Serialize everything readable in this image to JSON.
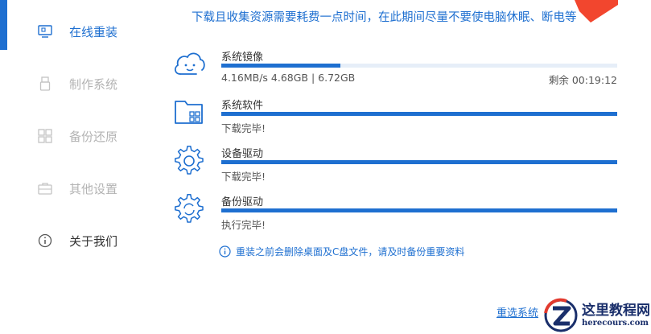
{
  "sidebar": {
    "items": [
      {
        "label": "在线重装",
        "icon": "monitor-icon",
        "state": "active"
      },
      {
        "label": "制作系统",
        "icon": "usb-icon",
        "state": "disabled"
      },
      {
        "label": "备份还原",
        "icon": "grid-icon",
        "state": "disabled"
      },
      {
        "label": "其他设置",
        "icon": "briefcase-icon",
        "state": "disabled"
      },
      {
        "label": "关于我们",
        "icon": "info-icon",
        "state": "normal"
      }
    ]
  },
  "header": {
    "message": "下载且收集资源需要耗费一点时间，在此期间尽量不要使电脑休眠、断电等"
  },
  "tasks": [
    {
      "name": "系统镜像",
      "icon": "cloud-face-icon",
      "progress": 0.3,
      "status": "4.16MB/s 4.68GB | 6.72GB",
      "remaining": "剩余 00:19:12"
    },
    {
      "name": "系统软件",
      "icon": "folder-apps-icon",
      "progress": 1.0,
      "status": "下载完毕!"
    },
    {
      "name": "设备驱动",
      "icon": "gear-icon",
      "progress": 1.0,
      "status": "下载完毕!"
    },
    {
      "name": "备份驱动",
      "icon": "gear-refresh-icon",
      "progress": 1.0,
      "status": "执行完毕!"
    }
  ],
  "notice": {
    "text": "重装之前会删除桌面及C盘文件，请及时备份重要资料",
    "icon": "info-icon"
  },
  "footer": {
    "reselect_label": "重选系统"
  },
  "watermark": {
    "title": "这里教程网",
    "url": "herecours.com"
  },
  "colors": {
    "accent": "#1e6fd0",
    "disabled": "#b3b3b3",
    "track": "#e6eef8",
    "arrow": "#f2462e"
  }
}
